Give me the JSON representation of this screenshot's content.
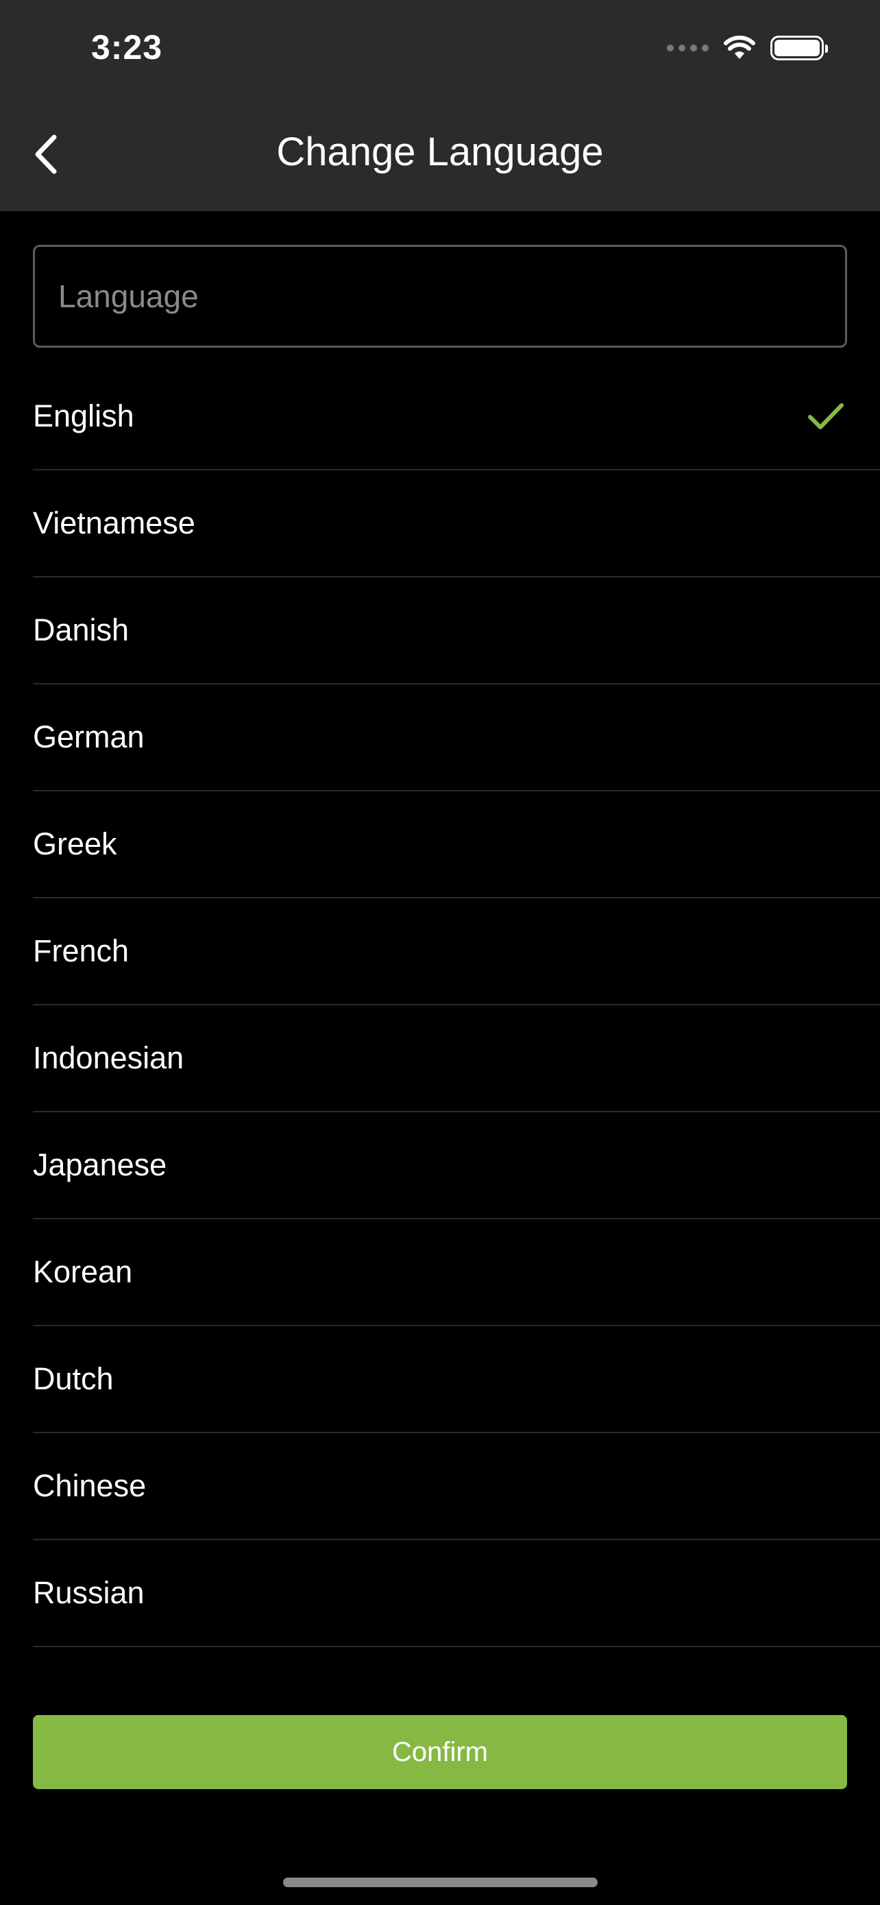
{
  "status_bar": {
    "time": "3:23"
  },
  "header": {
    "title": "Change Language",
    "back_icon": "chevron-left-icon"
  },
  "search": {
    "placeholder": "Language",
    "value": ""
  },
  "languages": [
    {
      "label": "English",
      "selected": true
    },
    {
      "label": "Vietnamese",
      "selected": false
    },
    {
      "label": "Danish",
      "selected": false
    },
    {
      "label": "German",
      "selected": false
    },
    {
      "label": "Greek",
      "selected": false
    },
    {
      "label": "French",
      "selected": false
    },
    {
      "label": "Indonesian",
      "selected": false
    },
    {
      "label": "Japanese",
      "selected": false
    },
    {
      "label": "Korean",
      "selected": false
    },
    {
      "label": "Dutch",
      "selected": false
    },
    {
      "label": "Chinese",
      "selected": false
    },
    {
      "label": "Russian",
      "selected": false
    }
  ],
  "confirm_label": "Confirm",
  "colors": {
    "accent": "#86b943",
    "header_bg": "#2b2b2b",
    "page_bg": "#000000"
  }
}
